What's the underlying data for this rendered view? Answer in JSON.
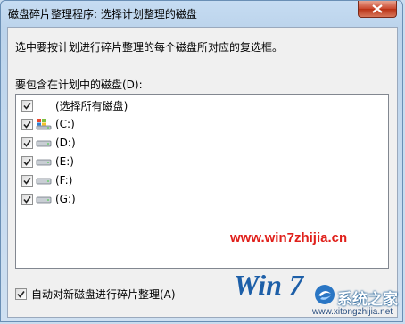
{
  "window": {
    "title": "磁盘碎片整理程序: 选择计划整理的磁盘"
  },
  "dialog": {
    "instruction": "选中要按计划进行碎片整理的每个磁盘所对应的复选框。",
    "list_caption": "要包含在计划中的磁盘(D):",
    "select_all_label": "(选择所有磁盘)",
    "disks": [
      {
        "label": "(C:)",
        "checked": true,
        "icon": "system-drive-icon"
      },
      {
        "label": "(D:)",
        "checked": true,
        "icon": "hard-drive-icon"
      },
      {
        "label": "(E:)",
        "checked": true,
        "icon": "hard-drive-icon"
      },
      {
        "label": "(F:)",
        "checked": true,
        "icon": "hard-drive-icon"
      },
      {
        "label": "(G:)",
        "checked": true,
        "icon": "hard-drive-icon"
      }
    ],
    "auto_defrag_label": "自动对新磁盘进行碎片整理(A)",
    "auto_defrag_checked": true
  },
  "watermark": {
    "url": "www.win7zhijia.cn",
    "logo_text": "Win 7",
    "brand": "系统之家",
    "site": "www.xitongzhijia.net",
    "url_color": "#e0201b"
  }
}
